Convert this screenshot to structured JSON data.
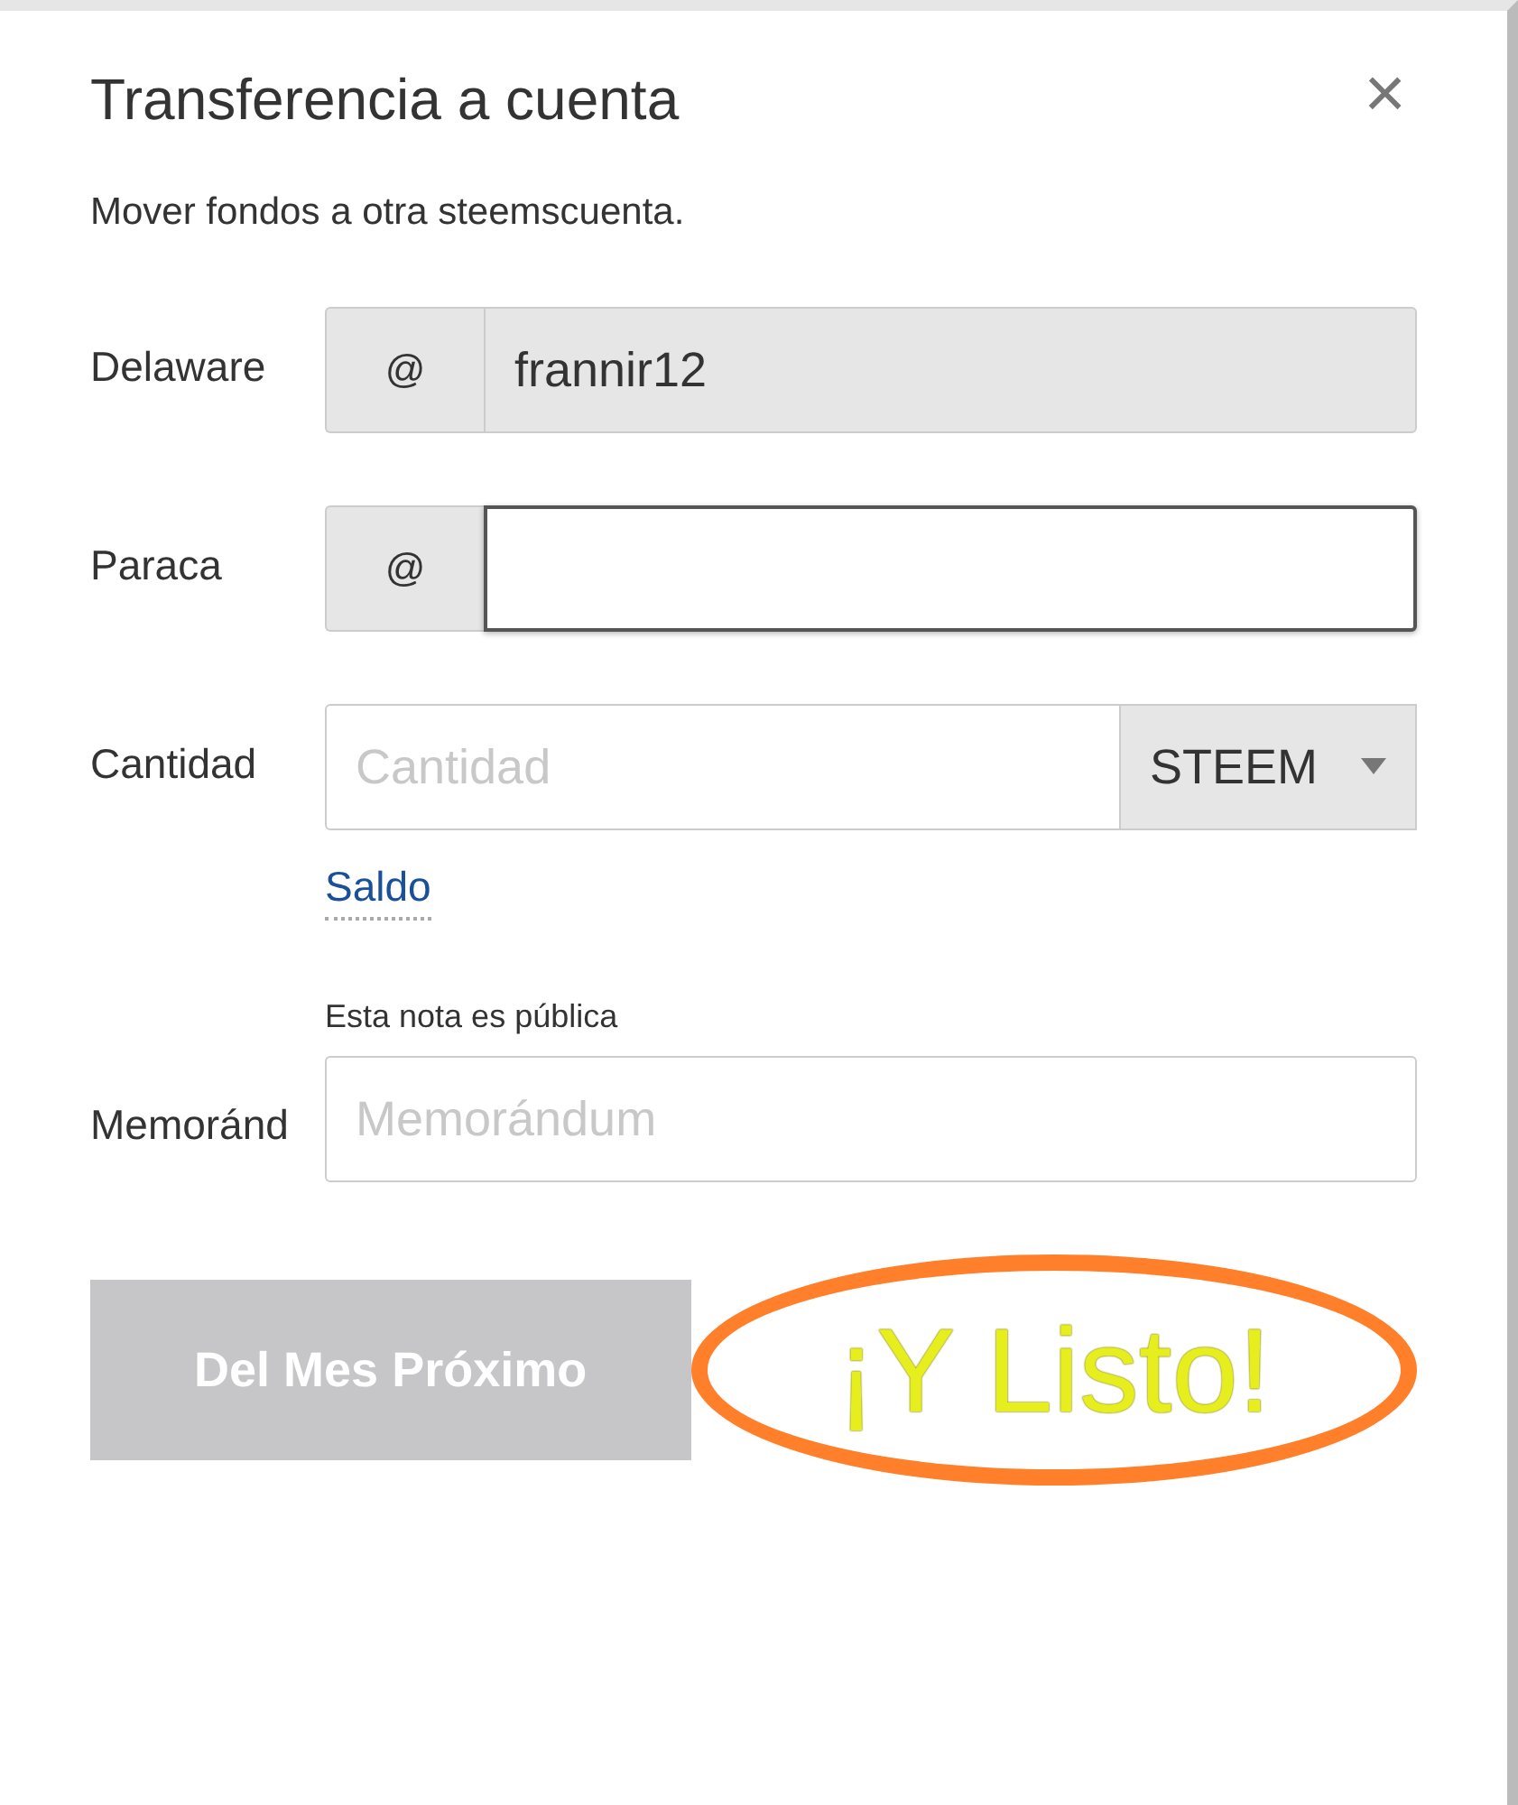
{
  "dialog": {
    "title": "Transferencia a cuenta",
    "close_icon": "×",
    "subtitle": "Mover fondos a otra steemscuenta."
  },
  "fields": [
    {
      "kind": "account",
      "label": "Delaware",
      "prefix": "@",
      "value": "frannir12",
      "readonly": true,
      "focused": false
    },
    {
      "kind": "account",
      "label": "Paraca",
      "prefix": "@",
      "readonly": false,
      "focused": true
    },
    {
      "kind": "amount",
      "label": "Cantidad",
      "placeholder": "Cantidad",
      "currency": "STEEM",
      "link": "Saldo"
    },
    {
      "kind": "memo",
      "label": "Memoránd",
      "note": "Esta nota es pública",
      "placeholder": "Memorándum"
    }
  ],
  "submit": {
    "label": "Del Mes Próximo",
    "disabled": true
  },
  "annotation": {
    "text": "¡Y Listo!"
  }
}
